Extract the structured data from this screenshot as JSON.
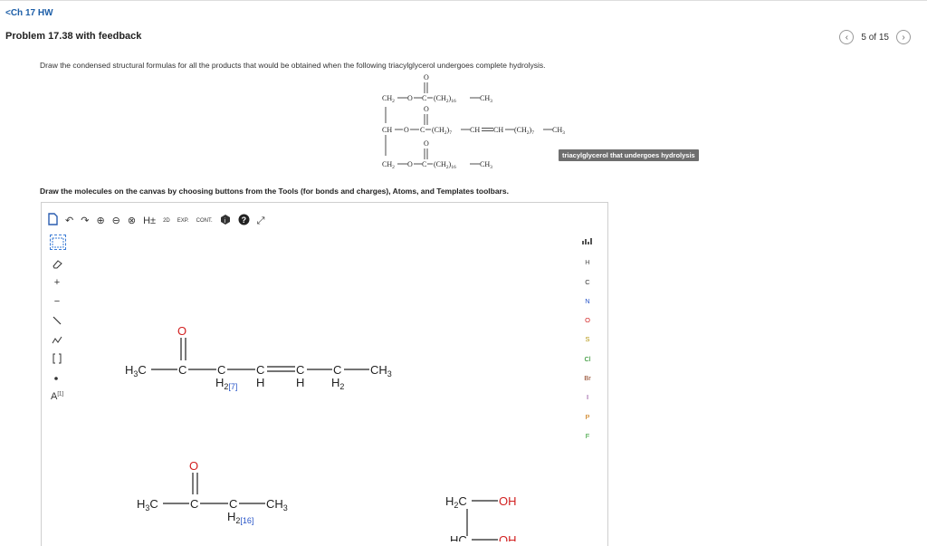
{
  "nav": {
    "back_label": "<Ch 17 HW"
  },
  "problem": {
    "title": "Problem 17.38 with feedback"
  },
  "pager": {
    "prev_icon": "chevron-left-icon",
    "position": "5 of 15",
    "next_icon": "chevron-right-icon"
  },
  "question": {
    "prompt": "Draw the condensed structural formulas for all the products that would be obtained when the following triacylglycerol undergoes complete hydrolysis.",
    "badge": "triacylglycerol that undergoes hydrolysis",
    "instructions": "Draw the molecules on the canvas by choosing buttons from the Tools (for bonds and charges), Atoms, and Templates toolbars."
  },
  "molecule": {
    "row1": {
      "o": "O",
      "a": "CH",
      "a_sub": "2",
      "b": "O",
      "c": "C",
      "d": "(CH",
      "d_sub": "2",
      "e": ")",
      "e_sub": "16",
      "f": "CH",
      "f_sub": "3"
    },
    "row2": {
      "o": "O",
      "a": "CH",
      "b": "O",
      "c": "C",
      "d": "(CH",
      "d_sub": "2",
      "e": ")",
      "e_sub": "7",
      "f": "CH",
      "g": "CH",
      "h": "(CH",
      "h_sub": "2",
      "i": ")",
      "i_sub": "7",
      "j": "CH",
      "j_sub": "3"
    },
    "row3": {
      "o": "O",
      "a": "CH",
      "a_sub": "2",
      "b": "O",
      "c": "C",
      "d": "(CH",
      "d_sub": "2",
      "e": ")",
      "e_sub": "16",
      "f": "CH",
      "f_sub": "3"
    }
  },
  "toolbar": {
    "icons": [
      "new-document-icon",
      "undo-icon",
      "redo-icon",
      "zoom-in-icon",
      "zoom-out-icon",
      "zoom-reset-icon",
      "hydrogen-toggle-icon",
      "2d-clean-icon",
      "expand-icon",
      "contract-icon",
      "info-icon",
      "help-icon",
      "fullscreen-icon"
    ],
    "h_label": "H±",
    "clean_label": "2D",
    "exp_label": "EXP.",
    "cont_label": "CONT."
  },
  "left_tools": {
    "icons": [
      "selection-icon",
      "eraser-icon",
      "positive-charge-icon",
      "negative-charge-icon",
      "single-bond-icon",
      "chain-icon",
      "bracket-icon",
      "radical-icon",
      "atom-label-icon"
    ],
    "plus": "+",
    "minus": "−",
    "atom_label": "A",
    "atom_label_sup": "[1]"
  },
  "atoms": [
    "H",
    "C",
    "N",
    "O",
    "S",
    "Cl",
    "Br",
    "I",
    "P",
    "F"
  ],
  "atoms_icon": "periodic-table-icon",
  "atom_colors": {
    "H": "#555555",
    "C": "#333333",
    "N": "#2855c8",
    "O": "#d22020",
    "S": "#b09000",
    "Cl": "#1e8a1e",
    "Br": "#8a3a1a",
    "I": "#7a2a8a",
    "P": "#c87000",
    "F": "#2a9a2a"
  },
  "canvas": {
    "mol1": {
      "o": "O",
      "ch3_left": "H",
      "ch3_left_sub": "3",
      "ch3_left_c": "C",
      "c1": "C",
      "c2": "C",
      "c2_h": "H",
      "c2_sub": "2",
      "c2_count": "[7]",
      "c3": "C",
      "c3_h": "H",
      "c4": "C",
      "c4_h": "H",
      "c5": "C",
      "c5_h": "H",
      "c5_sub": "2",
      "ch3_right": "CH",
      "ch3_right_sub": "3"
    },
    "mol2": {
      "o": "O",
      "ch3_left": "H",
      "ch3_left_sub": "3",
      "ch3_left_c": "C",
      "c1": "C",
      "c2": "C",
      "c2_h": "H",
      "c2_sub": "2",
      "c2_count": "[16]",
      "ch3_right": "CH",
      "ch3_right_sub": "3"
    },
    "mol3": {
      "h2c": "H",
      "h2c_sub": "2",
      "h2c_c": "C",
      "oh1": "OH",
      "hc": "HC",
      "oh2": "OH"
    }
  },
  "colors": {
    "link": "#1e5fa8",
    "oxygen": "#d22020",
    "count": "#2855c8",
    "badge": "#6e6e6e"
  }
}
